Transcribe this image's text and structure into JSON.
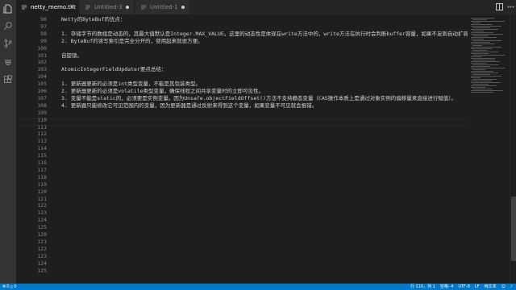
{
  "tabs": [
    {
      "name": "netty_memo.txt",
      "active": true,
      "closable": true
    },
    {
      "name": "Untitled-3",
      "active": false,
      "modified": true
    },
    {
      "name": "Untitled-1",
      "active": false,
      "modified": true
    }
  ],
  "activity_icons": [
    "files-icon",
    "search-icon",
    "source-control-icon",
    "debug-icon",
    "extensions-icon"
  ],
  "editor": {
    "lines": [
      {
        "n": "96",
        "text": "Netty的ByteBuf的优点："
      },
      {
        "n": "97",
        "text": ""
      },
      {
        "n": "98",
        "text": "1. 存储字节的数组是动态的，其最大值默认是Integer.MAX_VALUE。这里的动态性是体现在write方法中的，write方法在执行时会判断buffer容量，如果不足则自动扩容。"
      },
      {
        "n": "99",
        "text": "2. ByteBuf的读写索引是完全分开的，使用起来就很方便。"
      },
      {
        "n": "100",
        "text": ""
      },
      {
        "n": "101",
        "text": "自旋锁。"
      },
      {
        "n": "102",
        "text": ""
      },
      {
        "n": "103",
        "text": "AtomicIntegerFieldUpdater要点总结："
      },
      {
        "n": "104",
        "text": ""
      },
      {
        "n": "105",
        "text": "1. 更新器更新的必须是int类型变量，不能是其包装类型。"
      },
      {
        "n": "106",
        "text": "2. 更新器更新的必须是volatile类型变量，确保线程之间共享变量时的立即可见性。"
      },
      {
        "n": "107",
        "text": "3. 变量不能是static的，必须要是实例变量。因为Unsafe.objectFieldOffset()方法不支持静态变量（CAS操作本质上是通过对象实例的偏移量来直接进行赋值）。"
      },
      {
        "n": "108",
        "text": "4. 更新器只能修改它可见范围内的变量，因为更新器是通过反射来得到这个变量，如果变量不可见就会报错。"
      },
      {
        "n": "109",
        "text": ""
      },
      {
        "n": "110",
        "text": ""
      },
      {
        "n": "111",
        "text": ""
      },
      {
        "n": "112",
        "text": ""
      },
      {
        "n": "113",
        "text": ""
      },
      {
        "n": "114",
        "text": ""
      },
      {
        "n": "115",
        "text": ""
      },
      {
        "n": "116",
        "text": ""
      },
      {
        "n": "117",
        "text": ""
      },
      {
        "n": "118",
        "text": ""
      },
      {
        "n": "119",
        "text": ""
      },
      {
        "n": "120",
        "text": ""
      },
      {
        "n": "121",
        "text": ""
      },
      {
        "n": "122",
        "text": ""
      },
      {
        "n": "123",
        "text": ""
      },
      {
        "n": "124",
        "text": ""
      },
      {
        "n": "125",
        "text": ""
      },
      {
        "n": "120",
        "text": ""
      },
      {
        "n": "121",
        "text": ""
      },
      {
        "n": "122",
        "text": ""
      },
      {
        "n": "123",
        "text": ""
      },
      {
        "n": "124",
        "text": ""
      },
      {
        "n": "125",
        "text": ""
      }
    ]
  },
  "statusbar": {
    "errors": "0",
    "warnings": "0",
    "position": "行 110，列 1",
    "spaces": "空格: 4",
    "encoding": "UTF-8",
    "eol": "LF",
    "language": "纯文本"
  },
  "colors": {
    "status_bg": "#007acc",
    "editor_bg": "#1e1e1e",
    "tab_bg": "#2d2d2d",
    "activity_bg": "#333333"
  }
}
